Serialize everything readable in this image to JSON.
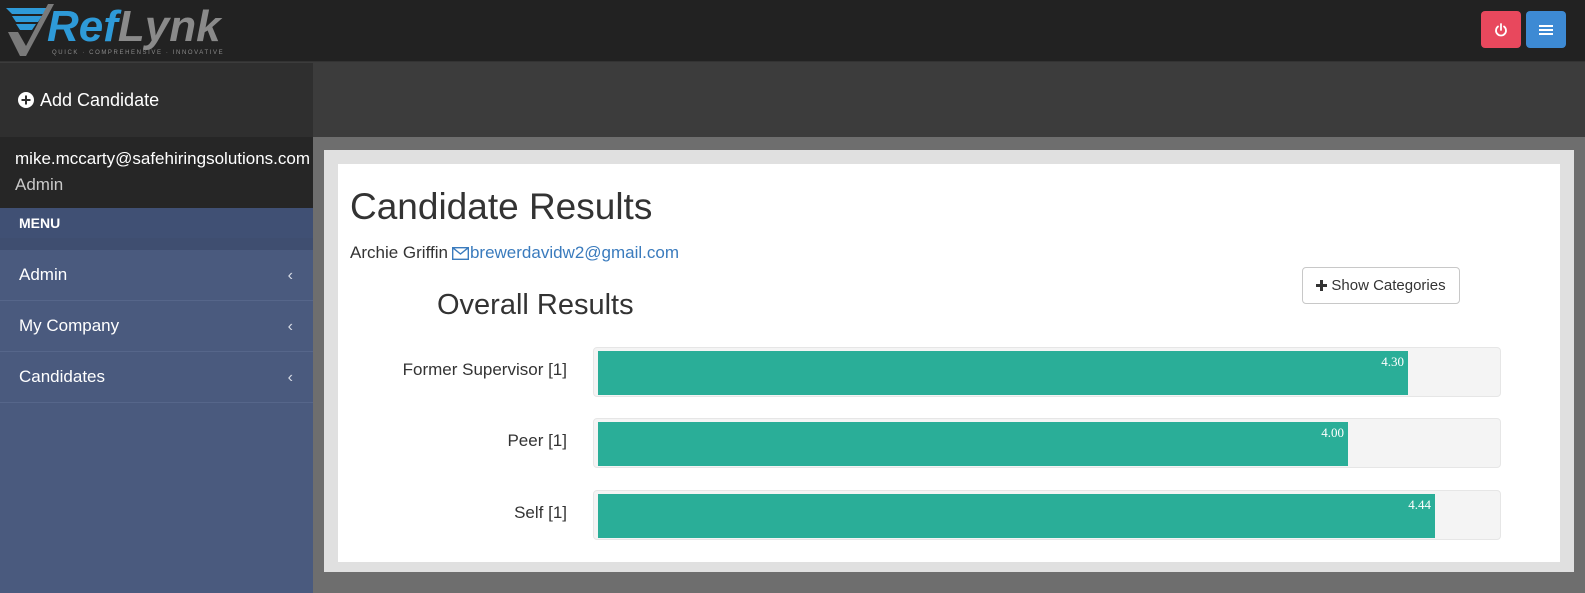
{
  "header": {
    "logo": {
      "brand_part1": "Ref",
      "brand_part2": "Lynk",
      "tagline": "QUICK · COMPREHENSIVE · INNOVATIVE"
    },
    "buttons": {
      "power_icon": "power-icon",
      "menu_icon": "hamburger-icon"
    },
    "colors": {
      "power": "#e8485d",
      "menu": "#3d8ad4"
    }
  },
  "sidebar": {
    "add_candidate_label": "Add Candidate",
    "user_email": "mike.mccarty@safehiringsolutions.com",
    "user_role": "Admin",
    "menu_label": "MENU",
    "items": [
      {
        "label": "Admin"
      },
      {
        "label": "My Company"
      },
      {
        "label": "Candidates"
      }
    ]
  },
  "main": {
    "title": "Candidate Results",
    "candidate_name": "Archie Griffin",
    "candidate_email": "brewerdavidw2@gmail.com",
    "show_categories_label": "Show Categories"
  },
  "chart_data": {
    "type": "bar",
    "orientation": "horizontal",
    "title": "Overall Results",
    "categories": [
      "Former Supervisor [1]",
      "Peer [1]",
      "Self [1]"
    ],
    "values": [
      4.3,
      4.0,
      4.44
    ],
    "value_labels": [
      "4.30",
      "4.00",
      "4.44"
    ],
    "xlim": [
      0,
      5
    ],
    "bar_color": "#2aae98",
    "legend": "none",
    "grid": false
  }
}
